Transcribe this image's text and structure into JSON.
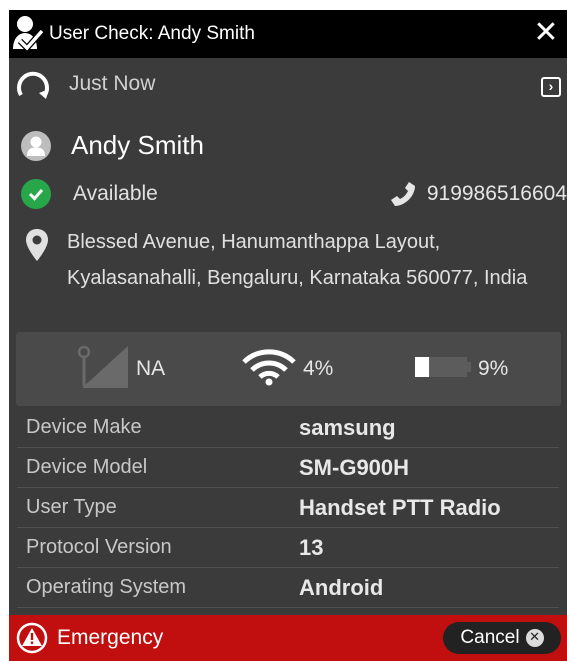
{
  "window": {
    "title": "User Check: Andy Smith",
    "close_glyph": "✕"
  },
  "refresh": {
    "label": "Just Now",
    "expand_glyph": "›"
  },
  "user": {
    "name": "Andy Smith",
    "status": "Available",
    "phone": "919986516604",
    "address": "Blessed Avenue, Hanumanthappa Layout, Kyalasanahalli, Bengaluru, Karnataka 560077, India"
  },
  "signal": {
    "cellular": "NA",
    "wifi": "4%",
    "battery": "9%",
    "battery_level": 0.09
  },
  "details": [
    {
      "label": "Device Make",
      "value": "samsung"
    },
    {
      "label": "Device Model",
      "value": "SM-G900H"
    },
    {
      "label": "User Type",
      "value": "Handset PTT Radio"
    },
    {
      "label": "Protocol Version",
      "value": "13"
    },
    {
      "label": "Operating System",
      "value": "Android"
    }
  ],
  "emergency": {
    "label": "Emergency",
    "cancel_label": "Cancel"
  },
  "colors": {
    "panel": "#3b3b3b",
    "titlebar": "#000000",
    "available": "#27a74a",
    "emergency": "#c10f0f"
  }
}
